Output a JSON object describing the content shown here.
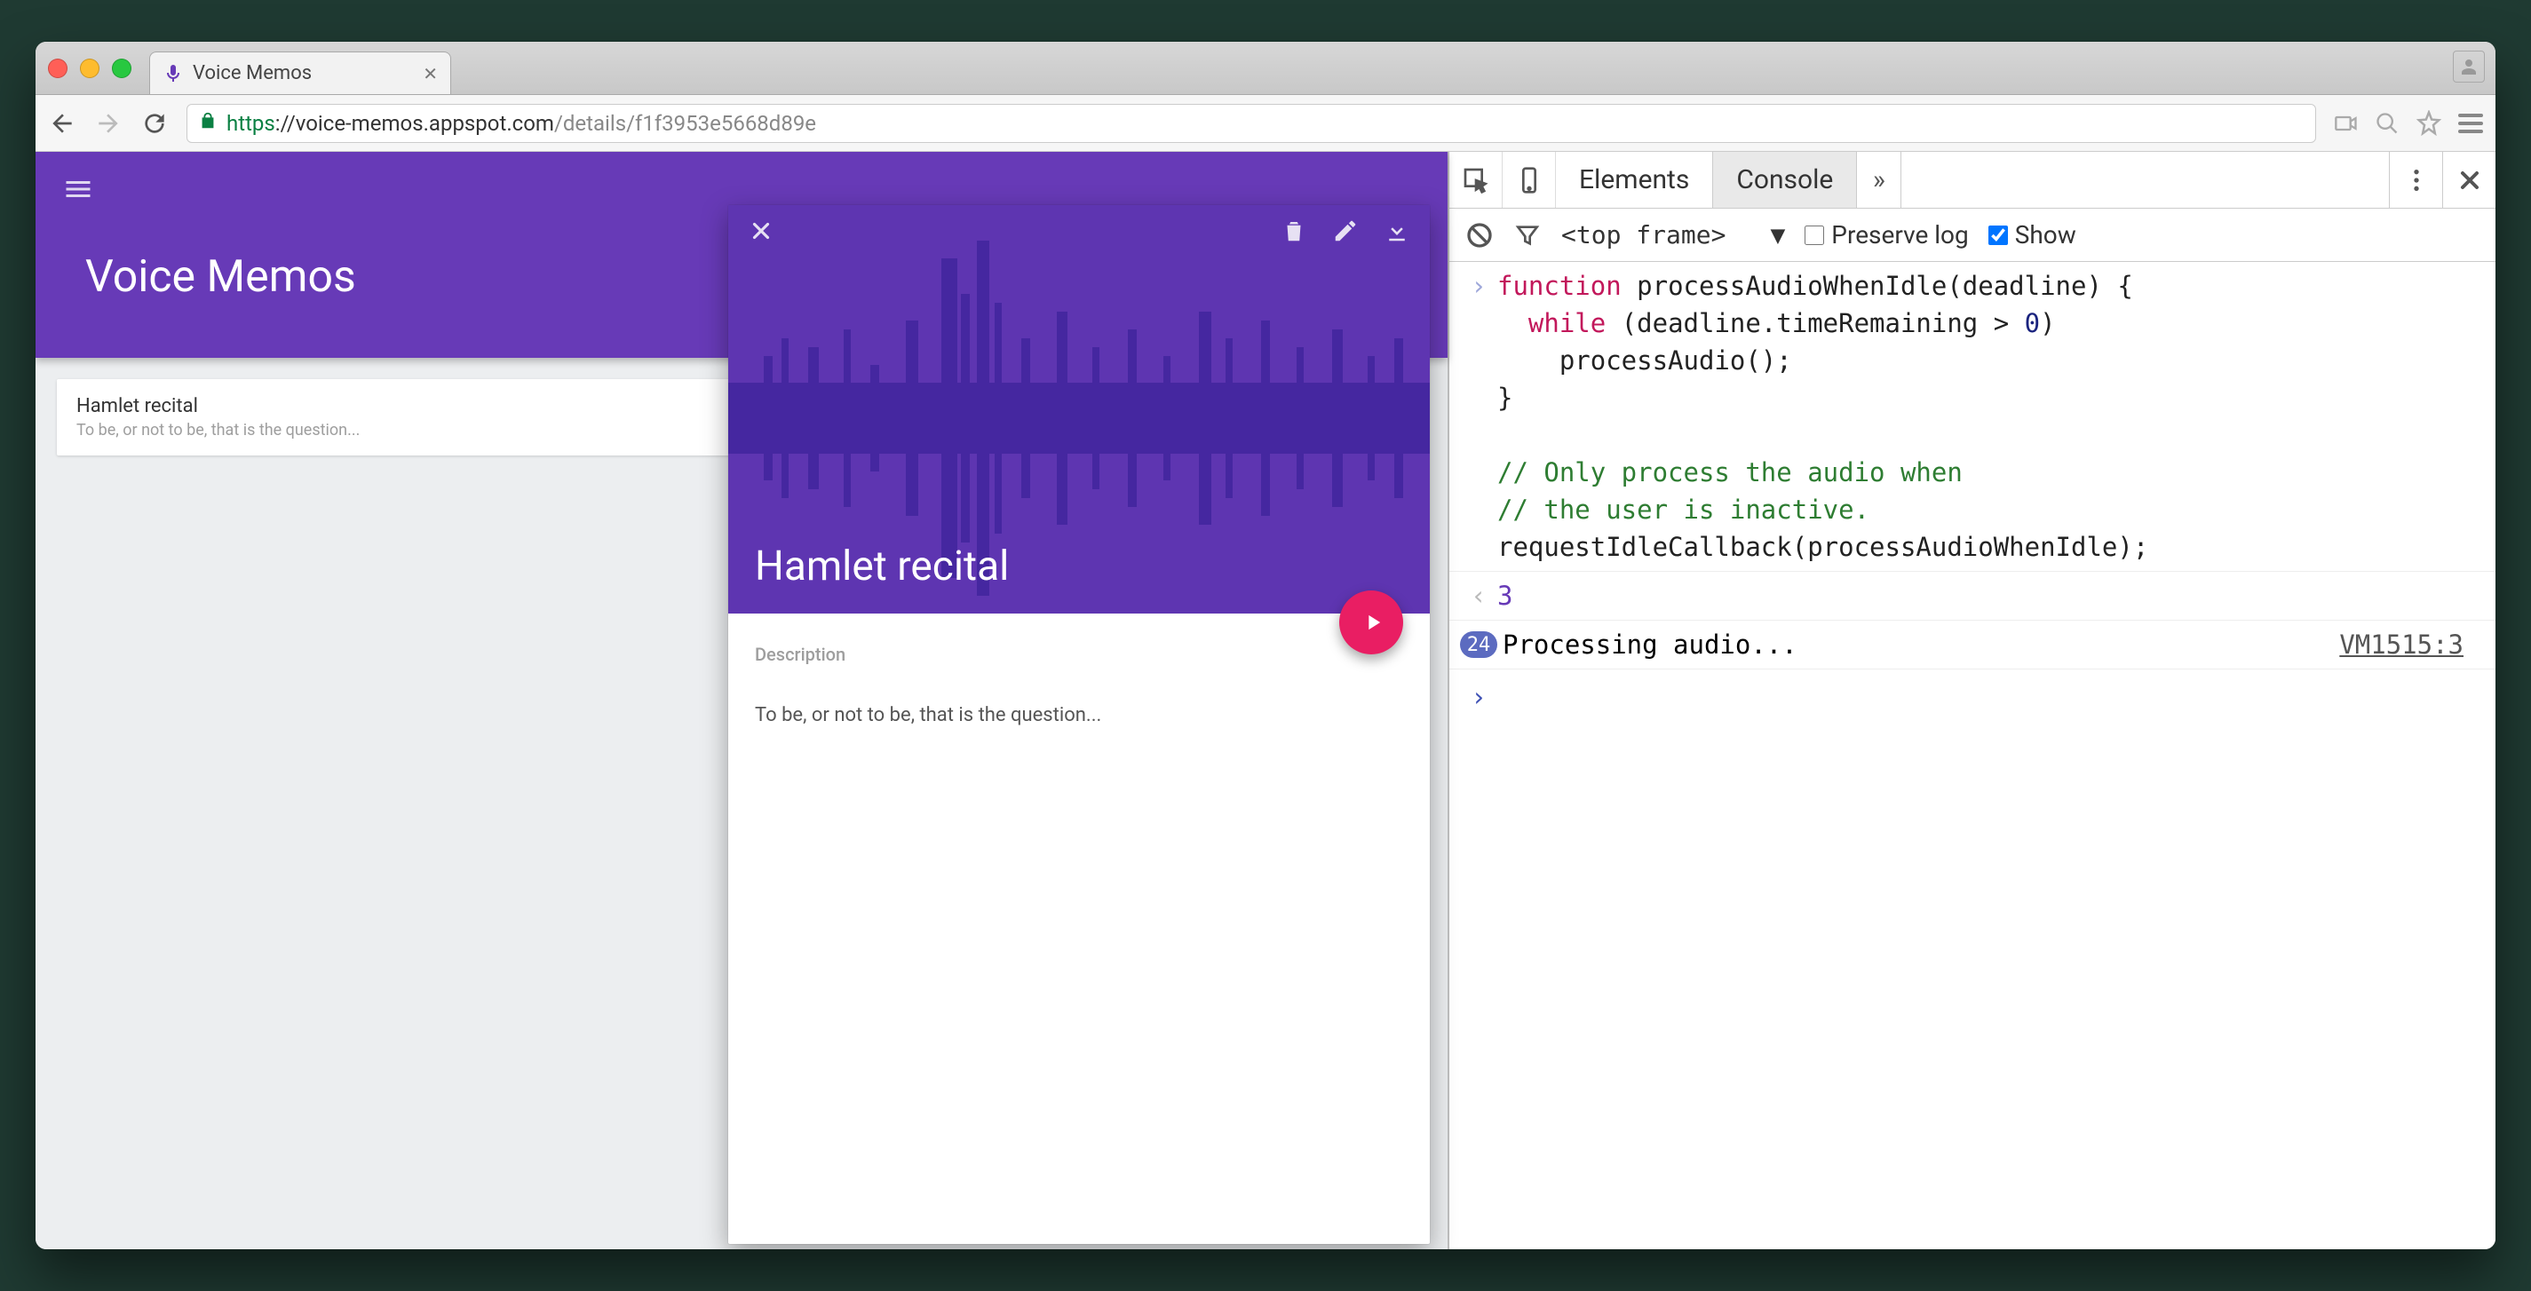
{
  "browser": {
    "tab_title": "Voice Memos",
    "url_protocol": "https",
    "url_host": "://voice-memos.appspot.com",
    "url_path": "/details/f1f3953e5668d89e"
  },
  "app": {
    "title": "Voice Memos",
    "memo": {
      "title": "Hamlet recital",
      "subtitle": "To be, or not to be, that is the question..."
    },
    "detail": {
      "title": "Hamlet recital",
      "description_label": "Description",
      "description": "To be, or not to be, that is the question..."
    }
  },
  "devtools": {
    "tabs": {
      "elements": "Elements",
      "console": "Console",
      "more": "»"
    },
    "frame": "<top frame>",
    "preserve_label": "Preserve log",
    "show_label": "Show",
    "code_lines": [
      [
        {
          "t": "function",
          "c": "k-magenta"
        },
        {
          "t": " processAudioWhenIdle(deadline) {"
        }
      ],
      [
        {
          "t": "  "
        },
        {
          "t": "while",
          "c": "k-magenta"
        },
        {
          "t": " (deadline.timeRemaining > "
        },
        {
          "t": "0",
          "c": "k-blue"
        },
        {
          "t": ")"
        }
      ],
      [
        {
          "t": "    processAudio();"
        }
      ],
      [
        {
          "t": "}"
        }
      ],
      [
        {
          "t": ""
        }
      ],
      [
        {
          "t": "// Only process the audio when",
          "c": "k-green"
        }
      ],
      [
        {
          "t": "// the user is inactive.",
          "c": "k-green"
        }
      ],
      [
        {
          "t": "requestIdleCallback(processAudioWhenIdle);"
        }
      ]
    ],
    "return_value": "3",
    "log_count": "24",
    "log_msg": "Processing audio...",
    "log_src": "VM1515:3"
  }
}
